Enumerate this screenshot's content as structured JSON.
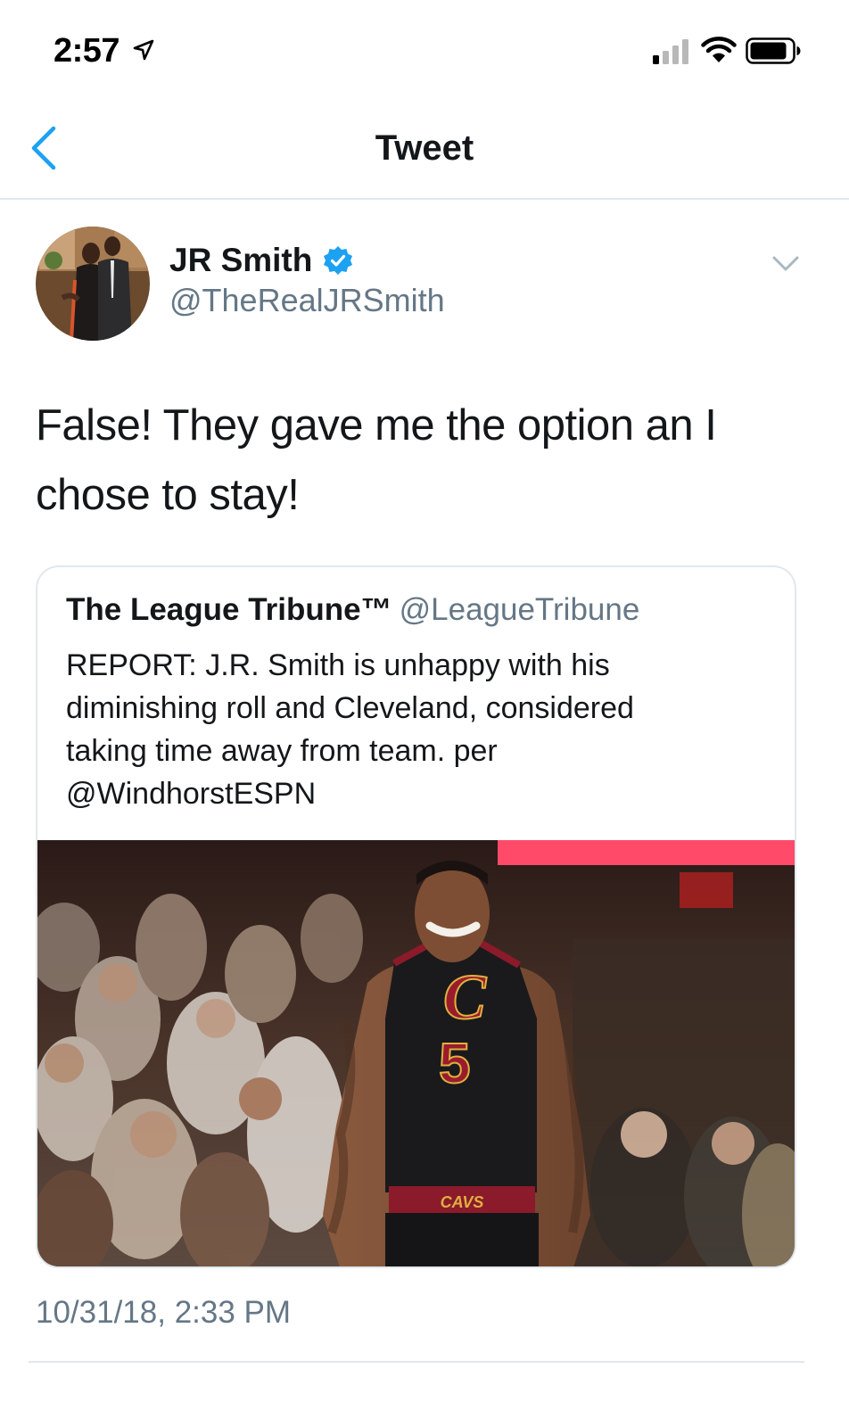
{
  "status_bar": {
    "time": "2:57",
    "location_icon": "location-arrow-icon",
    "signal_icon": "cellular-signal-icon",
    "wifi_icon": "wifi-icon",
    "battery_icon": "battery-icon"
  },
  "nav": {
    "back_icon": "chevron-left-icon",
    "title": "Tweet"
  },
  "tweet": {
    "author": {
      "name": "JR Smith",
      "handle": "@TheRealJRSmith",
      "verified": true,
      "avatar": "profile-photo"
    },
    "text_line_1": "False! They gave me the option an I",
    "text_line_2": "chose to stay!",
    "timestamp": "10/31/18, 2:33 PM",
    "quoted_tweet": {
      "name": "The League Tribune™",
      "handle": "@LeagueTribune",
      "text_line_1": "REPORT: J.R. Smith is unhappy with his",
      "text_line_2": "diminishing roll and Cleveland, considered",
      "text_line_3": "taking time away from team. per",
      "text_line_4": "@WindhorstESPN",
      "image": {
        "jersey_number": "5",
        "jersey_letter": "C",
        "waistband_text": "CAVS"
      }
    }
  },
  "colors": {
    "accent": "#1da1f2",
    "text_primary": "#14171a",
    "text_secondary": "#657786",
    "border": "#e1e8ed"
  }
}
